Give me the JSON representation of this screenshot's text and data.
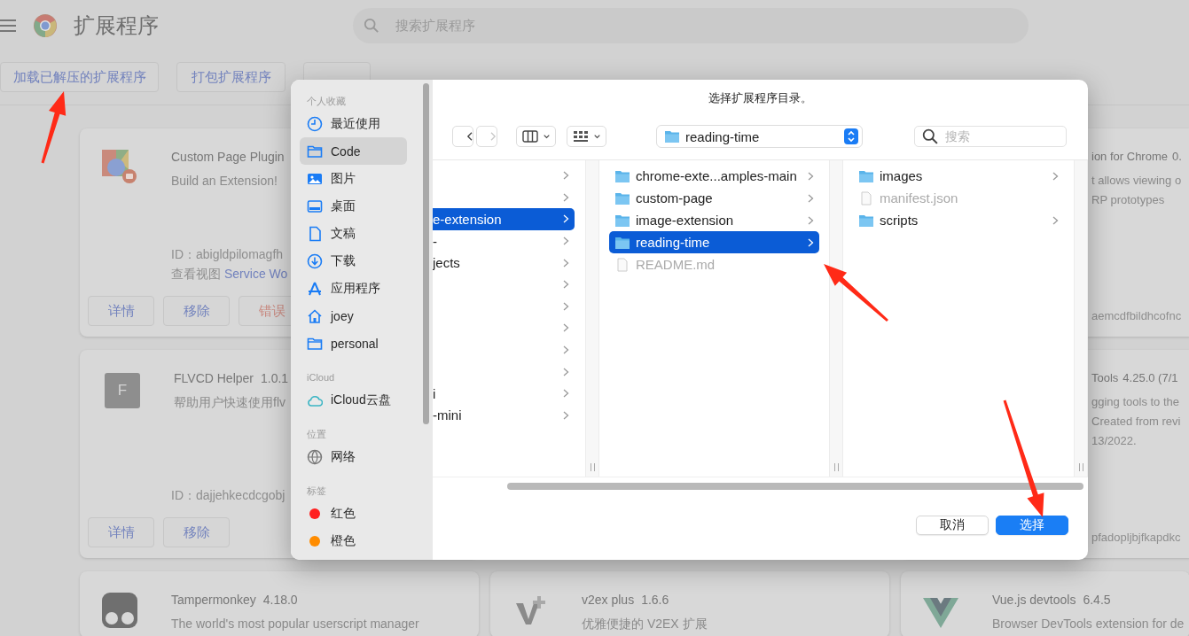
{
  "page": {
    "title": "扩展程序",
    "search": {
      "placeholder": "搜索扩展程序"
    },
    "actions": [
      {
        "label": "加载已解压的扩展程序"
      },
      {
        "label": "打包扩展程序"
      }
    ]
  },
  "card_rows": [
    {
      "left": {
        "kind": "puzzle",
        "name": "Custom Page Plugin",
        "description": [
          "Build an Extension!"
        ],
        "id": "ID：abigldpilomagfh",
        "view_label": "查看视图",
        "view_link": "Service Wo",
        "buttons": [
          {
            "label": "详情",
            "kind": "default"
          },
          {
            "label": "移除",
            "kind": "default"
          },
          {
            "label": "错误",
            "kind": "error"
          }
        ]
      },
      "right": {
        "name": "ion for Chrome",
        "version": "0.",
        "description": [
          "t allows viewing o",
          "RP prototypes"
        ],
        "id": "aemcdfbildhcofnc"
      }
    },
    {
      "left": {
        "kind": "letter",
        "icon_letter": "F",
        "name": "FLVCD Helper",
        "version": "1.0.1",
        "description": [
          "帮助用户快速使用flv"
        ],
        "id": "ID：dajjehkecdcgobj",
        "buttons": [
          {
            "label": "详情",
            "kind": "default"
          },
          {
            "label": "移除",
            "kind": "default"
          }
        ]
      },
      "right": {
        "name": "Tools",
        "version": "4.25.0 (7/1",
        "description": [
          "gging tools to the",
          "Created from revi",
          "13/2022."
        ],
        "id": "pfadopljbjfkapdkc"
      }
    },
    {
      "left": {
        "kind": "monkey",
        "name": "Tampermonkey",
        "version": "4.18.0",
        "description": [
          "The world's most popular userscript manager"
        ]
      },
      "middle": {
        "kind": "vplus",
        "name": "v2ex plus",
        "version": "1.6.6",
        "description": [
          "优雅便捷的 V2EX 扩展"
        ]
      },
      "right": {
        "kind": "vue",
        "name": "Vue.js devtools",
        "version": "6.4.5",
        "description": [
          "Browser DevTools extension for de"
        ]
      }
    }
  ],
  "dialog": {
    "title": "选择扩展程序目录。",
    "sidebar": [
      {
        "heading": "个人收藏",
        "items": [
          {
            "label": "最近使用",
            "kind": "clock",
            "selected": false
          },
          {
            "label": "Code",
            "kind": "folder",
            "selected": true
          },
          {
            "label": "图片",
            "kind": "photo",
            "selected": false
          },
          {
            "label": "桌面",
            "kind": "desktop",
            "selected": false
          },
          {
            "label": "文稿",
            "kind": "document",
            "selected": false
          },
          {
            "label": "下载",
            "kind": "download",
            "selected": false
          },
          {
            "label": "应用程序",
            "kind": "apps",
            "selected": false
          },
          {
            "label": "joey",
            "kind": "home",
            "selected": false
          },
          {
            "label": "personal",
            "kind": "folder",
            "selected": false
          }
        ]
      },
      {
        "heading": "iCloud",
        "items": [
          {
            "label": "iCloud云盘",
            "kind": "cloud",
            "selected": false
          }
        ]
      },
      {
        "heading": "位置",
        "items": [
          {
            "label": "网络",
            "kind": "globe",
            "selected": false
          }
        ]
      },
      {
        "heading": "标签",
        "items": [
          {
            "label": "红色",
            "kind": "tag",
            "color": "#ff1f1f",
            "selected": false
          },
          {
            "label": "橙色",
            "kind": "tag",
            "color": "#ff8c00",
            "selected": false
          }
        ]
      }
    ],
    "toolbar": {
      "back": {
        "disabled": false
      },
      "forward": {
        "disabled": true
      },
      "path": "reading-time",
      "search": {
        "placeholder": "搜索"
      }
    },
    "columns": [
      {
        "items": [
          {
            "selected": false,
            "has_children": true
          },
          {
            "selected": false,
            "has_children": true
          },
          {
            "name": "e-extension",
            "selected": true,
            "has_children": true
          },
          {
            "name": "-",
            "selected": false,
            "has_children": true
          },
          {
            "name": "jects",
            "selected": false,
            "has_children": true
          },
          {
            "selected": false,
            "has_children": true
          },
          {
            "selected": false,
            "has_children": true
          },
          {
            "selected": false,
            "has_children": true
          },
          {
            "selected": false,
            "has_children": true
          },
          {
            "selected": false,
            "has_children": true
          },
          {
            "name": "i",
            "selected": false,
            "has_children": true
          },
          {
            "name": "-mini",
            "selected": false,
            "has_children": true
          }
        ]
      },
      {
        "items": [
          {
            "name": "chrome-exte...amples-main",
            "kind": "folder",
            "selected": false,
            "has_children": true
          },
          {
            "name": "custom-page",
            "kind": "folder",
            "selected": false,
            "has_children": true
          },
          {
            "name": "image-extension",
            "kind": "folder",
            "selected": false,
            "has_children": true
          },
          {
            "name": "reading-time",
            "kind": "folder",
            "selected": true,
            "has_children": true
          },
          {
            "name": "README.md",
            "kind": "file",
            "selected": false,
            "has_children": false
          }
        ]
      },
      {
        "items": [
          {
            "name": "images",
            "kind": "folder",
            "selected": false,
            "has_children": true
          },
          {
            "name": "manifest.json",
            "kind": "file",
            "selected": false,
            "has_children": false
          },
          {
            "name": "scripts",
            "kind": "folder",
            "selected": false,
            "has_children": true
          }
        ]
      }
    ],
    "buttons": [
      {
        "label": "取消",
        "kind": "default"
      },
      {
        "label": "选择",
        "kind": "primary"
      }
    ]
  }
}
